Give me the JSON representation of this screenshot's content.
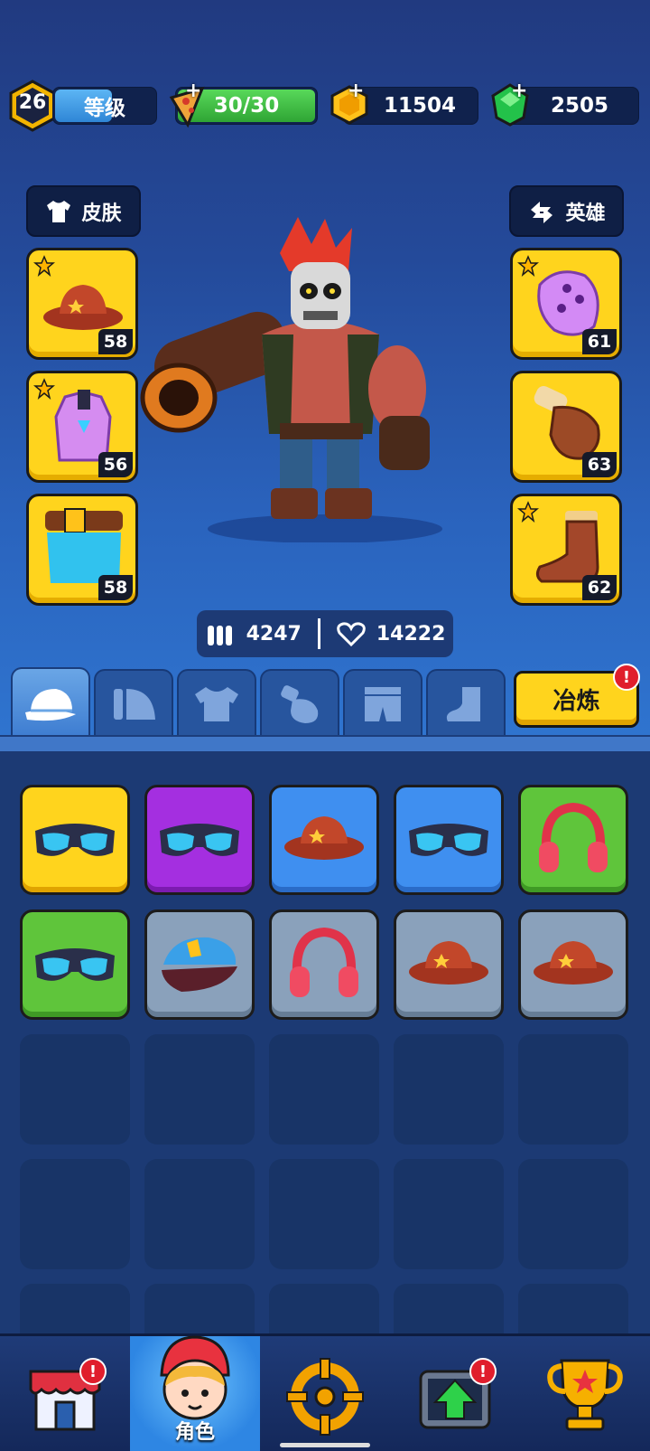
{
  "top_bar": {
    "player_level": "26",
    "level_label": "等级",
    "level_progress": 0.55,
    "energy": "30/30",
    "coins": "11504",
    "gems": "2505"
  },
  "hero_panel": {
    "skin_button": "皮肤",
    "hero_button": "英雄",
    "left_slots": [
      {
        "item": "cowboy-hat",
        "level": "58",
        "starred": true
      },
      {
        "item": "purple-vest",
        "level": "56",
        "starred": true
      },
      {
        "item": "belt-shorts",
        "level": "58",
        "starred": false
      }
    ],
    "right_slots": [
      {
        "item": "purple-armor",
        "level": "61",
        "starred": true
      },
      {
        "item": "glove",
        "level": "63",
        "starred": false
      },
      {
        "item": "boot",
        "level": "62",
        "starred": true
      }
    ],
    "attack": "4247",
    "health": "14222"
  },
  "tabs": [
    {
      "name": "hat",
      "icon": "cap-icon",
      "active": true
    },
    {
      "name": "armor",
      "icon": "shoulder-icon",
      "active": false
    },
    {
      "name": "shirt",
      "icon": "shirt-icon",
      "active": false
    },
    {
      "name": "glove",
      "icon": "glove-icon",
      "active": false
    },
    {
      "name": "pants",
      "icon": "pants-icon",
      "active": false
    },
    {
      "name": "boots",
      "icon": "boot-icon",
      "active": false
    }
  ],
  "refine_button": "冶炼",
  "alert_mark": "!",
  "inventory": [
    {
      "item": "goggles",
      "rarity": "yellow"
    },
    {
      "item": "goggles",
      "rarity": "purple"
    },
    {
      "item": "cowboy-hat",
      "rarity": "blue"
    },
    {
      "item": "goggles",
      "rarity": "blue"
    },
    {
      "item": "headphones",
      "rarity": "green"
    },
    {
      "item": "goggles",
      "rarity": "green"
    },
    {
      "item": "police-cap",
      "rarity": "gray"
    },
    {
      "item": "headphones",
      "rarity": "gray"
    },
    {
      "item": "cowboy-hat",
      "rarity": "gray"
    },
    {
      "item": "cowboy-hat",
      "rarity": "gray"
    }
  ],
  "bottom_nav": {
    "items": [
      "shop",
      "character",
      "battle",
      "upgrade",
      "trophy"
    ],
    "active_label": "角色"
  },
  "colors": {
    "rarity_yellow": "#ffd41d",
    "rarity_purple": "#a42fe0",
    "rarity_blue": "#3f8ff0",
    "rarity_green": "#5fc53b",
    "rarity_gray": "#8aa1bb"
  }
}
